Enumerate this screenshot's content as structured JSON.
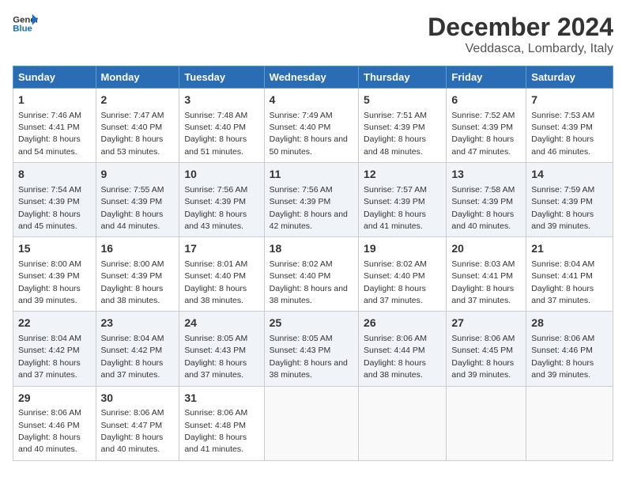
{
  "header": {
    "logo_line1": "General",
    "logo_line2": "Blue",
    "title": "December 2024",
    "subtitle": "Veddasca, Lombardy, Italy"
  },
  "weekdays": [
    "Sunday",
    "Monday",
    "Tuesday",
    "Wednesday",
    "Thursday",
    "Friday",
    "Saturday"
  ],
  "weeks": [
    [
      {
        "day": "1",
        "sunrise": "Sunrise: 7:46 AM",
        "sunset": "Sunset: 4:41 PM",
        "daylight": "Daylight: 8 hours and 54 minutes."
      },
      {
        "day": "2",
        "sunrise": "Sunrise: 7:47 AM",
        "sunset": "Sunset: 4:40 PM",
        "daylight": "Daylight: 8 hours and 53 minutes."
      },
      {
        "day": "3",
        "sunrise": "Sunrise: 7:48 AM",
        "sunset": "Sunset: 4:40 PM",
        "daylight": "Daylight: 8 hours and 51 minutes."
      },
      {
        "day": "4",
        "sunrise": "Sunrise: 7:49 AM",
        "sunset": "Sunset: 4:40 PM",
        "daylight": "Daylight: 8 hours and 50 minutes."
      },
      {
        "day": "5",
        "sunrise": "Sunrise: 7:51 AM",
        "sunset": "Sunset: 4:39 PM",
        "daylight": "Daylight: 8 hours and 48 minutes."
      },
      {
        "day": "6",
        "sunrise": "Sunrise: 7:52 AM",
        "sunset": "Sunset: 4:39 PM",
        "daylight": "Daylight: 8 hours and 47 minutes."
      },
      {
        "day": "7",
        "sunrise": "Sunrise: 7:53 AM",
        "sunset": "Sunset: 4:39 PM",
        "daylight": "Daylight: 8 hours and 46 minutes."
      }
    ],
    [
      {
        "day": "8",
        "sunrise": "Sunrise: 7:54 AM",
        "sunset": "Sunset: 4:39 PM",
        "daylight": "Daylight: 8 hours and 45 minutes."
      },
      {
        "day": "9",
        "sunrise": "Sunrise: 7:55 AM",
        "sunset": "Sunset: 4:39 PM",
        "daylight": "Daylight: 8 hours and 44 minutes."
      },
      {
        "day": "10",
        "sunrise": "Sunrise: 7:56 AM",
        "sunset": "Sunset: 4:39 PM",
        "daylight": "Daylight: 8 hours and 43 minutes."
      },
      {
        "day": "11",
        "sunrise": "Sunrise: 7:56 AM",
        "sunset": "Sunset: 4:39 PM",
        "daylight": "Daylight: 8 hours and 42 minutes."
      },
      {
        "day": "12",
        "sunrise": "Sunrise: 7:57 AM",
        "sunset": "Sunset: 4:39 PM",
        "daylight": "Daylight: 8 hours and 41 minutes."
      },
      {
        "day": "13",
        "sunrise": "Sunrise: 7:58 AM",
        "sunset": "Sunset: 4:39 PM",
        "daylight": "Daylight: 8 hours and 40 minutes."
      },
      {
        "day": "14",
        "sunrise": "Sunrise: 7:59 AM",
        "sunset": "Sunset: 4:39 PM",
        "daylight": "Daylight: 8 hours and 39 minutes."
      }
    ],
    [
      {
        "day": "15",
        "sunrise": "Sunrise: 8:00 AM",
        "sunset": "Sunset: 4:39 PM",
        "daylight": "Daylight: 8 hours and 39 minutes."
      },
      {
        "day": "16",
        "sunrise": "Sunrise: 8:00 AM",
        "sunset": "Sunset: 4:39 PM",
        "daylight": "Daylight: 8 hours and 38 minutes."
      },
      {
        "day": "17",
        "sunrise": "Sunrise: 8:01 AM",
        "sunset": "Sunset: 4:40 PM",
        "daylight": "Daylight: 8 hours and 38 minutes."
      },
      {
        "day": "18",
        "sunrise": "Sunrise: 8:02 AM",
        "sunset": "Sunset: 4:40 PM",
        "daylight": "Daylight: 8 hours and 38 minutes."
      },
      {
        "day": "19",
        "sunrise": "Sunrise: 8:02 AM",
        "sunset": "Sunset: 4:40 PM",
        "daylight": "Daylight: 8 hours and 37 minutes."
      },
      {
        "day": "20",
        "sunrise": "Sunrise: 8:03 AM",
        "sunset": "Sunset: 4:41 PM",
        "daylight": "Daylight: 8 hours and 37 minutes."
      },
      {
        "day": "21",
        "sunrise": "Sunrise: 8:04 AM",
        "sunset": "Sunset: 4:41 PM",
        "daylight": "Daylight: 8 hours and 37 minutes."
      }
    ],
    [
      {
        "day": "22",
        "sunrise": "Sunrise: 8:04 AM",
        "sunset": "Sunset: 4:42 PM",
        "daylight": "Daylight: 8 hours and 37 minutes."
      },
      {
        "day": "23",
        "sunrise": "Sunrise: 8:04 AM",
        "sunset": "Sunset: 4:42 PM",
        "daylight": "Daylight: 8 hours and 37 minutes."
      },
      {
        "day": "24",
        "sunrise": "Sunrise: 8:05 AM",
        "sunset": "Sunset: 4:43 PM",
        "daylight": "Daylight: 8 hours and 37 minutes."
      },
      {
        "day": "25",
        "sunrise": "Sunrise: 8:05 AM",
        "sunset": "Sunset: 4:43 PM",
        "daylight": "Daylight: 8 hours and 38 minutes."
      },
      {
        "day": "26",
        "sunrise": "Sunrise: 8:06 AM",
        "sunset": "Sunset: 4:44 PM",
        "daylight": "Daylight: 8 hours and 38 minutes."
      },
      {
        "day": "27",
        "sunrise": "Sunrise: 8:06 AM",
        "sunset": "Sunset: 4:45 PM",
        "daylight": "Daylight: 8 hours and 39 minutes."
      },
      {
        "day": "28",
        "sunrise": "Sunrise: 8:06 AM",
        "sunset": "Sunset: 4:46 PM",
        "daylight": "Daylight: 8 hours and 39 minutes."
      }
    ],
    [
      {
        "day": "29",
        "sunrise": "Sunrise: 8:06 AM",
        "sunset": "Sunset: 4:46 PM",
        "daylight": "Daylight: 8 hours and 40 minutes."
      },
      {
        "day": "30",
        "sunrise": "Sunrise: 8:06 AM",
        "sunset": "Sunset: 4:47 PM",
        "daylight": "Daylight: 8 hours and 40 minutes."
      },
      {
        "day": "31",
        "sunrise": "Sunrise: 8:06 AM",
        "sunset": "Sunset: 4:48 PM",
        "daylight": "Daylight: 8 hours and 41 minutes."
      },
      null,
      null,
      null,
      null
    ]
  ]
}
